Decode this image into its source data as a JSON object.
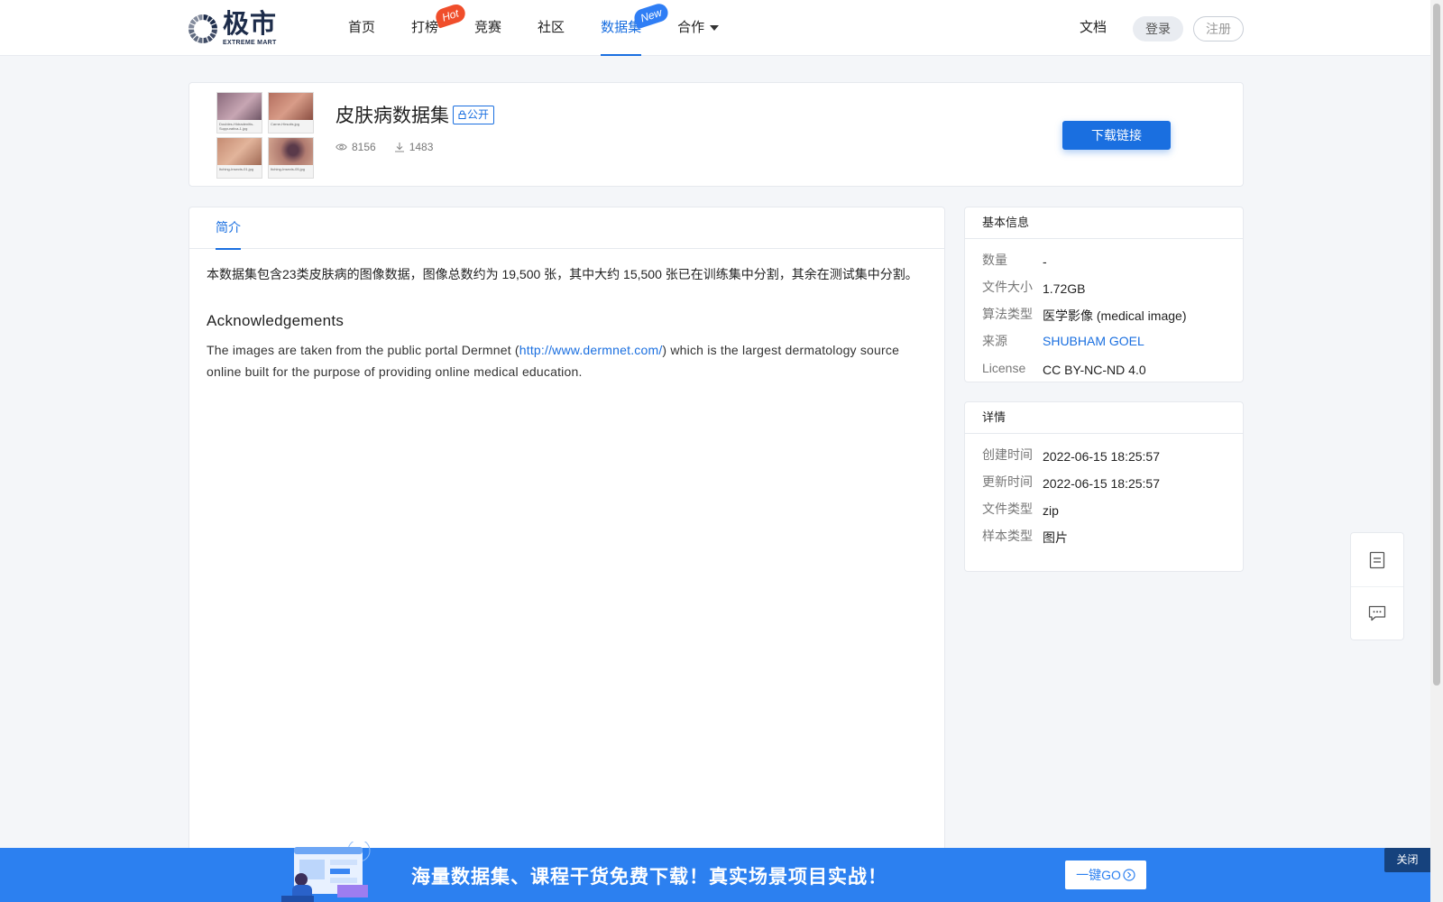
{
  "header": {
    "logo_cn": "极市",
    "logo_en": "EXTREME MART",
    "nav": [
      {
        "label": "首页"
      },
      {
        "label": "打榜",
        "badge": "Hot"
      },
      {
        "label": "竞赛"
      },
      {
        "label": "社区"
      },
      {
        "label": "数据集",
        "badge": "New"
      },
      {
        "label": "合作"
      }
    ],
    "docs": "文档",
    "login": "登录",
    "register": "注册"
  },
  "dataset": {
    "title": "皮肤病数据集",
    "visibility": "公开",
    "views": "8156",
    "downloads": "1483",
    "download_button": "下载链接",
    "thumbnails": [
      {
        "caption": "Doubles-Hidradenitis-Suppurativa-1.jpg"
      },
      {
        "caption": "Carne-Hirsutis.jpg"
      },
      {
        "caption": "Itching-Insects-01.jpg"
      },
      {
        "caption": "Itching-Insects-05.jpg"
      }
    ]
  },
  "main": {
    "tab": "简介",
    "intro": "本数据集包含23类皮肤病的图像数据，图像总数约为 19,500 张，其中大约 15,500 张已在训练集中分割，其余在测试集中分割。",
    "ack_title": "Acknowledgements",
    "ack_before": "The images are taken from the public portal Dermnet (",
    "ack_link": "http://www.dermnet.com/",
    "ack_after": ") which is the largest dermatology source online built for the purpose of providing online medical education."
  },
  "basic_info": {
    "title": "基本信息",
    "rows": [
      {
        "key": "数量",
        "value": "-"
      },
      {
        "key": "文件大小",
        "value": "1.72GB"
      },
      {
        "key": "算法类型",
        "value": "医学影像 (medical image)"
      },
      {
        "key": "来源",
        "value": "SHUBHAM GOEL"
      },
      {
        "key": "License",
        "value": "CC BY-NC-ND 4.0"
      }
    ]
  },
  "details": {
    "title": "详情",
    "rows": [
      {
        "key": "创建时间",
        "value": "2022-06-15 18:25:57"
      },
      {
        "key": "更新时间",
        "value": "2022-06-15 18:25:57"
      },
      {
        "key": "文件类型",
        "value": "zip"
      },
      {
        "key": "样本类型",
        "value": "图片"
      }
    ]
  },
  "banner": {
    "text": "海量数据集、课程干货免费下载！真实场景项目实战！",
    "go_button": "一键GO",
    "close": "关闭"
  },
  "colors": {
    "accent": "#1a6fe0",
    "hot_badge": "#f04e2b",
    "new_badge": "#2f7ef5",
    "banner": "#2c80f0"
  }
}
